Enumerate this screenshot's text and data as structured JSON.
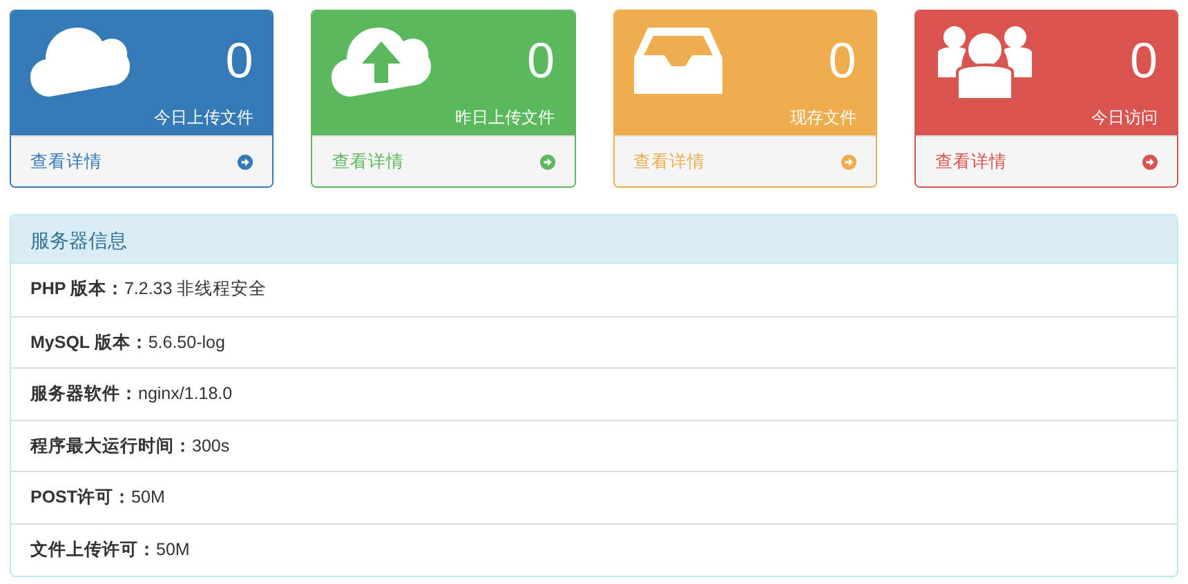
{
  "stats": [
    {
      "kind": "cloud",
      "color": "#337ab7",
      "count": "0",
      "label": "今日上传文件",
      "link": "查看详情"
    },
    {
      "kind": "upload",
      "color": "#5cb85c",
      "count": "0",
      "label": "昨日上传文件",
      "link": "查看详情"
    },
    {
      "kind": "inbox",
      "color": "#f0ad4e",
      "count": "0",
      "label": "现存文件",
      "link": "查看详情"
    },
    {
      "kind": "users",
      "color": "#d9534f",
      "count": "0",
      "label": "今日访问",
      "link": "查看详情"
    }
  ],
  "server_panel": {
    "title": "服务器信息",
    "rows": [
      "**PHP 版本：**7.2.33 非线程安全",
      "**MySQL 版本：**5.6.50-log",
      "**服务器软件：**nginx/1.18.0",
      "**程序最大运行时间：**300s",
      "**POST许可：**50M",
      "**文件上传许可：**50M"
    ]
  }
}
